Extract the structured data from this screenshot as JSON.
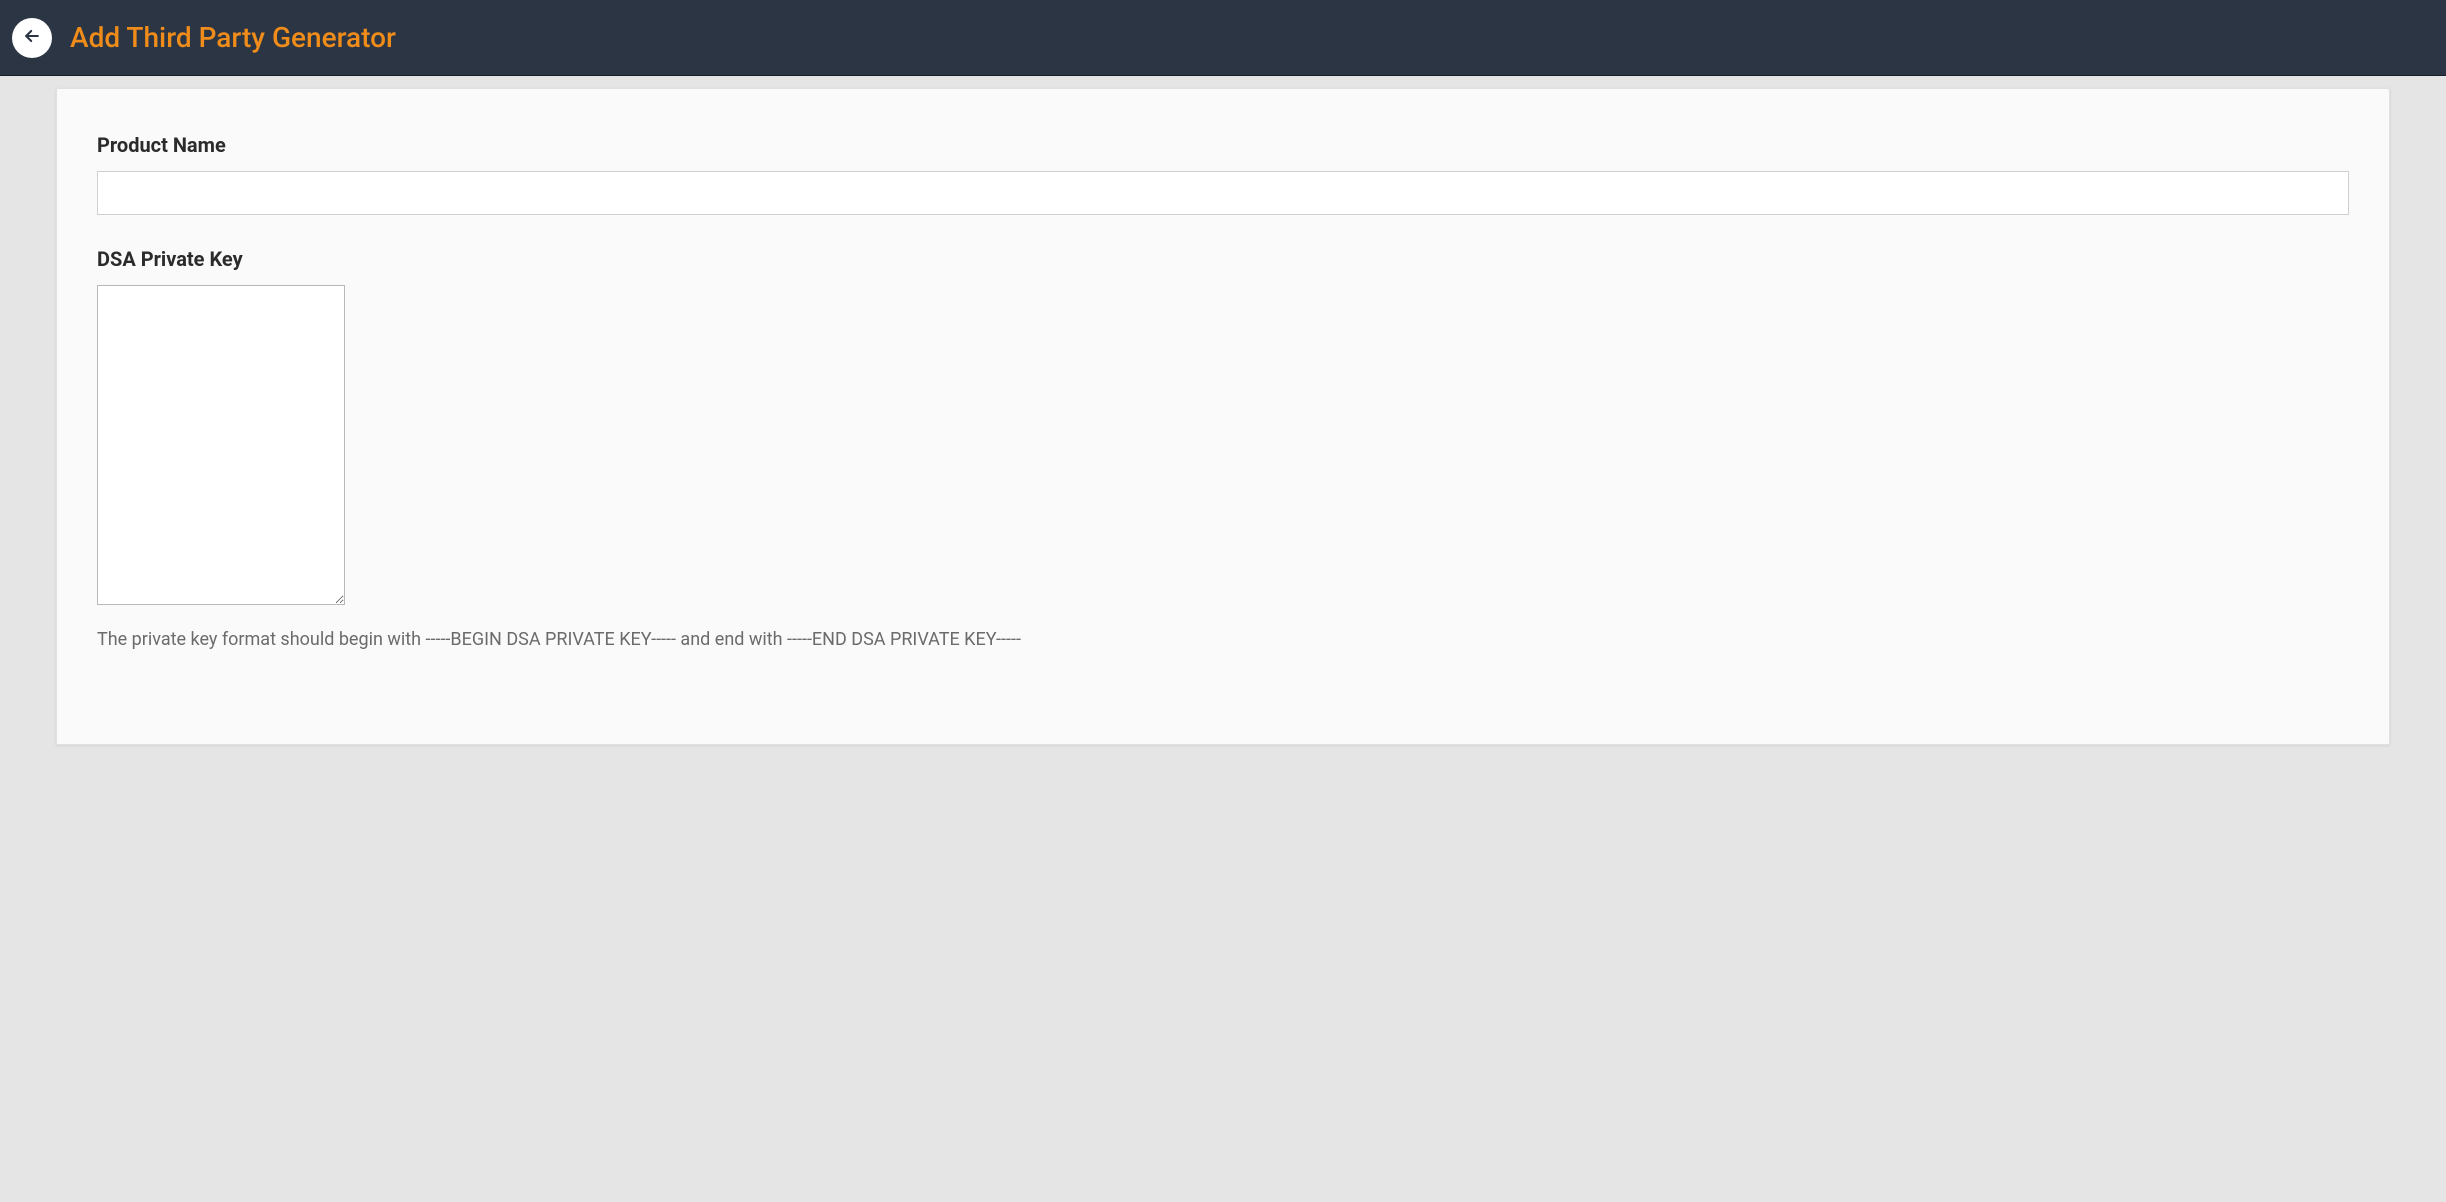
{
  "header": {
    "title": "Add Third Party Generator"
  },
  "form": {
    "product_name": {
      "label": "Product Name",
      "value": ""
    },
    "dsa_private_key": {
      "label": "DSA Private Key",
      "value": "",
      "help": "The private key format should begin with -----BEGIN DSA PRIVATE KEY----- and end with -----END DSA PRIVATE KEY-----"
    }
  }
}
